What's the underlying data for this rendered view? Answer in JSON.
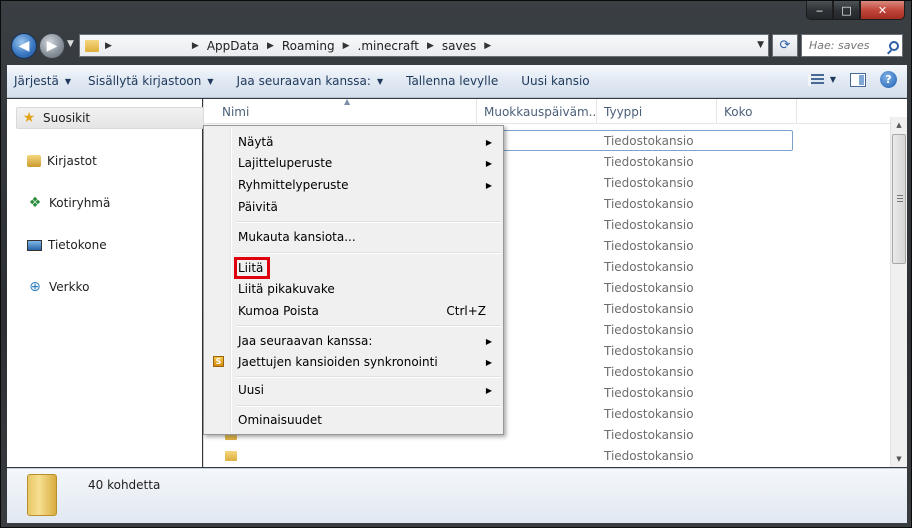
{
  "window": {
    "caption_buttons": {
      "minimize": "‒",
      "maximize": "□",
      "close": "✕"
    }
  },
  "address": {
    "crumbs": [
      "AppData",
      "Roaming",
      ".minecraft",
      "saves"
    ],
    "search_placeholder": "Hae: saves"
  },
  "toolbar": {
    "organize": "Järjestä",
    "include_in_library": "Sisällytä kirjastoon",
    "share_with": "Jaa seuraavan kanssa:",
    "burn": "Tallenna levylle",
    "new_folder": "Uusi kansio"
  },
  "navpane": {
    "favorites": "Suosikit",
    "libraries": "Kirjastot",
    "homegroup": "Kotiryhmä",
    "computer": "Tietokone",
    "network": "Verkko"
  },
  "columns": {
    "name": "Nimi",
    "modified": "Muokkauspäiväm...",
    "type": "Tyyppi",
    "size": "Koko"
  },
  "rows": [
    {
      "type": "Tiedostokansio"
    },
    {
      "type": "Tiedostokansio"
    },
    {
      "type": "Tiedostokansio"
    },
    {
      "type": "Tiedostokansio"
    },
    {
      "type": "Tiedostokansio"
    },
    {
      "type": "Tiedostokansio"
    },
    {
      "type": "Tiedostokansio"
    },
    {
      "type": "Tiedostokansio"
    },
    {
      "type": "Tiedostokansio"
    },
    {
      "type": "Tiedostokansio"
    },
    {
      "type": "Tiedostokansio"
    },
    {
      "type": "Tiedostokansio"
    },
    {
      "type": "Tiedostokansio"
    },
    {
      "type": "Tiedostokansio"
    },
    {
      "type": "Tiedostokansio"
    },
    {
      "type": "Tiedostokansio"
    }
  ],
  "context_menu": {
    "view": "Näytä",
    "sort_by": "Lajitteluperuste",
    "group_by": "Ryhmittelyperuste",
    "refresh": "Päivitä",
    "customize": "Mukauta kansiota...",
    "paste": "Liitä",
    "paste_shortcut": "Liitä pikakuvake",
    "undo_delete": "Kumoa Poista",
    "undo_shortcut": "Ctrl+Z",
    "share_with": "Jaa seuraavan kanssa:",
    "sync_shared": "Jaettujen kansioiden synkronointi",
    "new": "Uusi",
    "properties": "Ominaisuudet"
  },
  "details": {
    "item_count": "40 kohdetta"
  },
  "colors": {
    "highlight_border": "#e0000b",
    "toolbar_text": "#1e395b",
    "column_header_text": "#4c607a"
  }
}
